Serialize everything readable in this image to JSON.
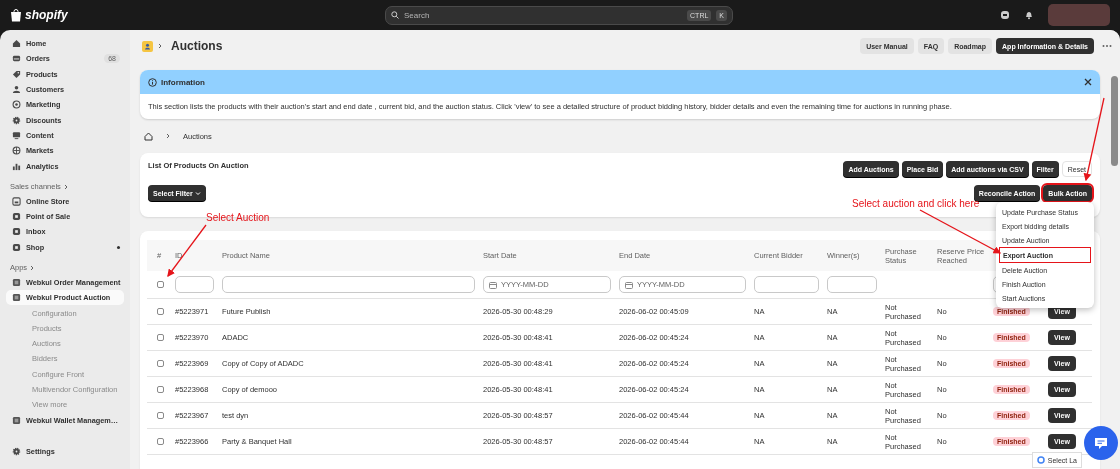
{
  "top_bar": {
    "logo": "shopify",
    "search": {
      "placeholder": "Search",
      "shortcut": [
        "CTRL",
        "K"
      ]
    }
  },
  "sidebar": {
    "groups": [
      {
        "items": [
          {
            "label": "Home",
            "selected": false
          },
          {
            "label": "Orders",
            "badge": "68",
            "selected": false
          },
          {
            "label": "Products",
            "selected": false
          },
          {
            "label": "Customers",
            "selected": false
          },
          {
            "label": "Marketing",
            "selected": false
          },
          {
            "label": "Discounts",
            "selected": false
          },
          {
            "label": "Content",
            "selected": false
          },
          {
            "label": "Markets",
            "selected": false
          },
          {
            "label": "Analytics",
            "selected": false
          }
        ]
      },
      {
        "heading": "Sales channels",
        "items": [
          {
            "label": "Online Store",
            "selected": false
          },
          {
            "label": "Point of Sale",
            "selected": false
          },
          {
            "label": "Inbox",
            "selected": false
          },
          {
            "label": "Shop",
            "selected": false
          }
        ]
      },
      {
        "heading": "Apps",
        "items": [
          {
            "label": "Webkul Order Management",
            "selected": false
          },
          {
            "label": "Webkul Product Auction",
            "selected": true,
            "children": [
              {
                "label": "Configuration",
                "selected": false
              },
              {
                "label": "Products",
                "selected": false
              },
              {
                "label": "Auctions",
                "selected": false
              },
              {
                "label": "Bidders",
                "selected": false
              },
              {
                "label": "Configure Front",
                "selected": false
              },
              {
                "label": "Multivendor Configuration",
                "selected": false
              },
              {
                "label": "View more",
                "selected": false
              }
            ]
          },
          {
            "label": "Webkul Wallet Managem…",
            "selected": false
          }
        ]
      }
    ],
    "settings": "Settings"
  },
  "page": {
    "title": "Auctions",
    "buttons": [
      {
        "label": "User Manual",
        "primary": false
      },
      {
        "label": "FAQ",
        "primary": false
      },
      {
        "label": "Roadmap",
        "primary": false
      },
      {
        "label": "App Information & Details",
        "primary": true
      }
    ]
  },
  "info": {
    "title": "Information",
    "text": "This section lists the products with their auction's start and end date , current bid, and the auction status. Click 'view' to see a detailed structure of product bidding history, bidder details and even the remaining time for auctions in running phase."
  },
  "breadcrumb": [
    "Auctions"
  ],
  "products_card": {
    "title": "List Of Products On Auction",
    "actions": [
      {
        "label": "Add Auctions",
        "kind": "dark"
      },
      {
        "label": "Place Bid",
        "kind": "dark"
      },
      {
        "label": "Add auctions via CSV",
        "kind": "dark"
      },
      {
        "label": "Filter",
        "kind": "dark"
      },
      {
        "label": "Reset",
        "kind": "plain"
      }
    ],
    "filter_button": "Select Filter",
    "secondary_actions": [
      {
        "label": "Reconcile Action",
        "annotated": false
      },
      {
        "label": "Bulk Action",
        "annotated": true
      }
    ],
    "bulk_menu": [
      {
        "label": "Update Purchase Status",
        "annotated": false
      },
      {
        "label": "Export bidding details",
        "annotated": false
      },
      {
        "label": "Update Auction",
        "annotated": false
      },
      {
        "label": "Export Auction",
        "annotated": true
      },
      {
        "label": "Delete Auction",
        "annotated": false
      },
      {
        "label": "Finish Auction",
        "annotated": false
      },
      {
        "label": "Start Auctions",
        "annotated": false
      }
    ]
  },
  "table": {
    "columns": [
      "#",
      "ID",
      "Product Name",
      "Start Date",
      "End Date",
      "Current Bidder",
      "Winner(s)",
      "Purchase Status",
      "Reserve Price Reached"
    ],
    "filters": [
      {
        "kind": "checkbox",
        "checked": false
      },
      {
        "kind": "text"
      },
      {
        "kind": "text"
      },
      {
        "kind": "date",
        "placeholder": "YYYY-MM-DD"
      },
      {
        "kind": "date",
        "placeholder": "YYYY-MM-DD"
      },
      {
        "kind": "text"
      },
      {
        "kind": "text"
      },
      {
        "kind": "none"
      },
      {
        "kind": "none"
      },
      {
        "kind": "text"
      },
      {
        "kind": "none"
      }
    ],
    "rows": [
      {
        "selected": false,
        "id": "#5223971",
        "product": "Future Publish",
        "start": "2026-05-30 00:48:29",
        "end": "2026-06-02 00:45:09",
        "bidder": "NA",
        "winner": "NA",
        "purchase": "Not Purchased",
        "reserve": "No",
        "status": "Finished",
        "action": "View"
      },
      {
        "selected": false,
        "id": "#5223970",
        "product": "ADADC",
        "start": "2026-05-30 00:48:41",
        "end": "2026-06-02 00:45:24",
        "bidder": "NA",
        "winner": "NA",
        "purchase": "Not Purchased",
        "reserve": "No",
        "status": "Finished",
        "action": "View"
      },
      {
        "selected": false,
        "id": "#5223969",
        "product": "Copy of Copy of ADADC",
        "start": "2026-05-30 00:48:41",
        "end": "2026-06-02 00:45:24",
        "bidder": "NA",
        "winner": "NA",
        "purchase": "Not Purchased",
        "reserve": "No",
        "status": "Finished",
        "action": "View"
      },
      {
        "selected": false,
        "id": "#5223968",
        "product": "Copy of demooo",
        "start": "2026-05-30 00:48:41",
        "end": "2026-06-02 00:45:24",
        "bidder": "NA",
        "winner": "NA",
        "purchase": "Not Purchased",
        "reserve": "No",
        "status": "Finished",
        "action": "View"
      },
      {
        "selected": false,
        "id": "#5223967",
        "product": "test dyn",
        "start": "2026-05-30 00:48:57",
        "end": "2026-06-02 00:45:44",
        "bidder": "NA",
        "winner": "NA",
        "purchase": "Not Purchased",
        "reserve": "No",
        "status": "Finished",
        "action": "View"
      },
      {
        "selected": false,
        "id": "#5223966",
        "product": "Party & Banquet Hall",
        "start": "2026-05-30 00:48:57",
        "end": "2026-06-02 00:45:44",
        "bidder": "NA",
        "winner": "NA",
        "purchase": "Not Purchased",
        "reserve": "No",
        "status": "Finished",
        "action": "View"
      }
    ]
  },
  "annotations": [
    "Select Auction",
    "Select auction and click here"
  ],
  "translate": {
    "label": "Select La"
  }
}
